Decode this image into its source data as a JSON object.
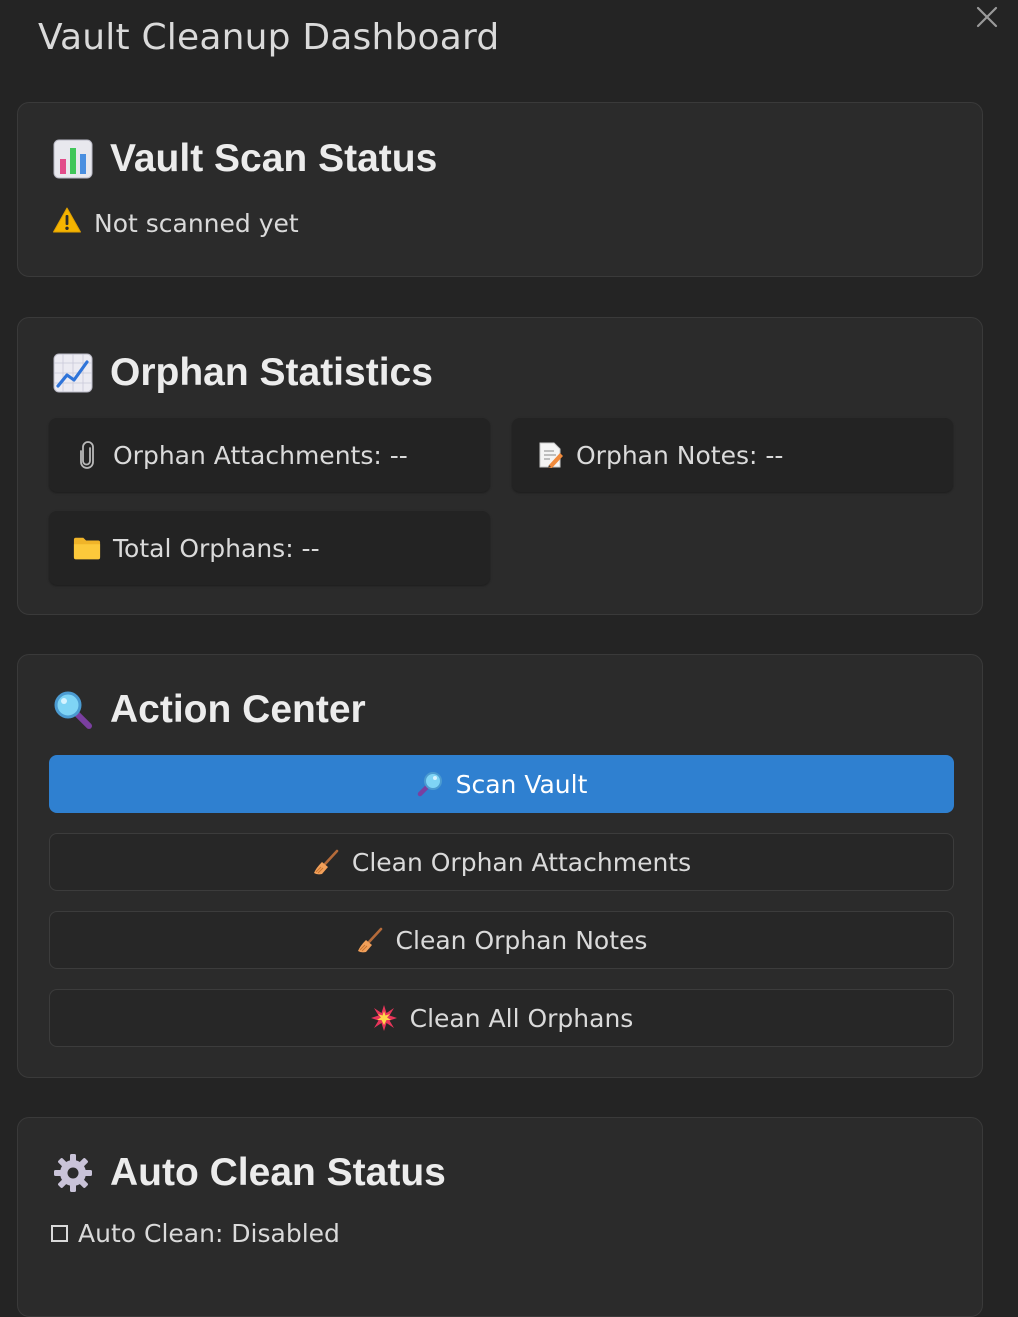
{
  "header": {
    "title": "Vault Cleanup Dashboard",
    "close_icon": "close-icon"
  },
  "scan_status": {
    "title": "Vault Scan Status",
    "icon": "bar-chart-icon",
    "status_icon": "warning-icon",
    "status_text": "Not scanned yet"
  },
  "orphan_stats": {
    "title": "Orphan Statistics",
    "icon": "trend-chart-icon",
    "items": [
      {
        "icon": "paperclip-icon",
        "label": "Orphan Attachments: --"
      },
      {
        "icon": "memo-icon",
        "label": "Orphan Notes: --"
      },
      {
        "icon": "folder-icon",
        "label": "Total Orphans: --"
      }
    ]
  },
  "action_center": {
    "title": "Action Center",
    "icon": "magnifier-icon",
    "accent_color": "#2f80d0",
    "buttons": [
      {
        "icon": "magnifier-icon",
        "label": "Scan Vault"
      },
      {
        "icon": "broom-icon",
        "label": "Clean Orphan Attachments"
      },
      {
        "icon": "broom-icon",
        "label": "Clean Orphan Notes"
      },
      {
        "icon": "collision-icon",
        "label": "Clean All Orphans"
      }
    ]
  },
  "auto_clean": {
    "title": "Auto Clean Status",
    "icon": "gear-icon",
    "status_icon": "checkbox-icon",
    "status_text": "Auto Clean: Disabled"
  }
}
